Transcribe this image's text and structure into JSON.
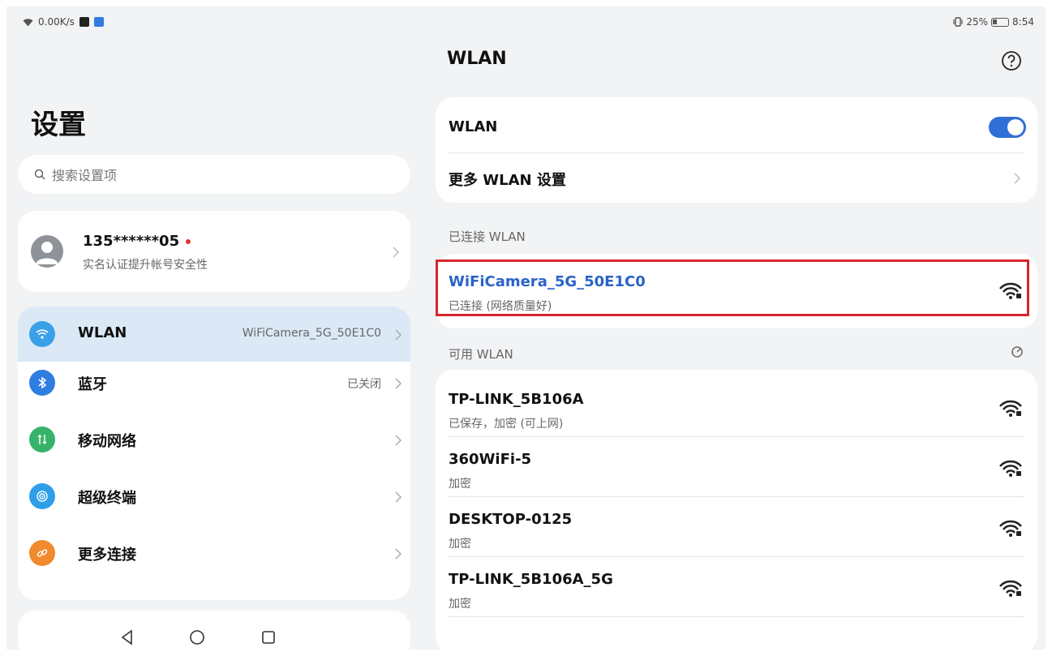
{
  "status_bar": {
    "speed": "0.00K/s",
    "battery": "25%",
    "time": "8:54"
  },
  "left": {
    "title": "设置",
    "search_placeholder": "搜索设置项",
    "account": {
      "phone": "135******05",
      "subtitle": "实名认证提升帐号安全性"
    },
    "menu": [
      {
        "label": "WLAN",
        "value": "WiFiCamera_5G_50E1C0",
        "icon": "wifi-icon",
        "color": "#3aa0e8"
      },
      {
        "label": "蓝牙",
        "value": "已关闭",
        "icon": "bluetooth-icon",
        "color": "#2f7de1"
      },
      {
        "label": "移动网络",
        "value": "",
        "icon": "mobile-network-icon",
        "color": "#36b36a"
      },
      {
        "label": "超级终端",
        "value": "",
        "icon": "super-device-icon",
        "color": "#2f9ee8"
      },
      {
        "label": "更多连接",
        "value": "",
        "icon": "link-icon",
        "color": "#f08a2c"
      }
    ]
  },
  "right": {
    "title": "WLAN",
    "wlan_toggle_label": "WLAN",
    "wlan_enabled": true,
    "more_settings_label": "更多 WLAN 设置",
    "connected_section": "已连接 WLAN",
    "connected": {
      "name": "WiFiCamera_5G_50E1C0",
      "status": "已连接 (网络质量好)"
    },
    "available_section": "可用 WLAN",
    "networks": [
      {
        "name": "TP-LINK_5B106A",
        "status": "已保存，加密 (可上网)"
      },
      {
        "name": "360WiFi-5",
        "status": "加密"
      },
      {
        "name": "DESKTOP-0125",
        "status": "加密"
      },
      {
        "name": "TP-LINK_5B106A_5G",
        "status": "加密"
      }
    ]
  },
  "colors": {
    "accent": "#2f6fd6",
    "connected_text": "#2a63c9",
    "highlight_border": "#d9262c",
    "active_row": "#dbe9f7"
  }
}
